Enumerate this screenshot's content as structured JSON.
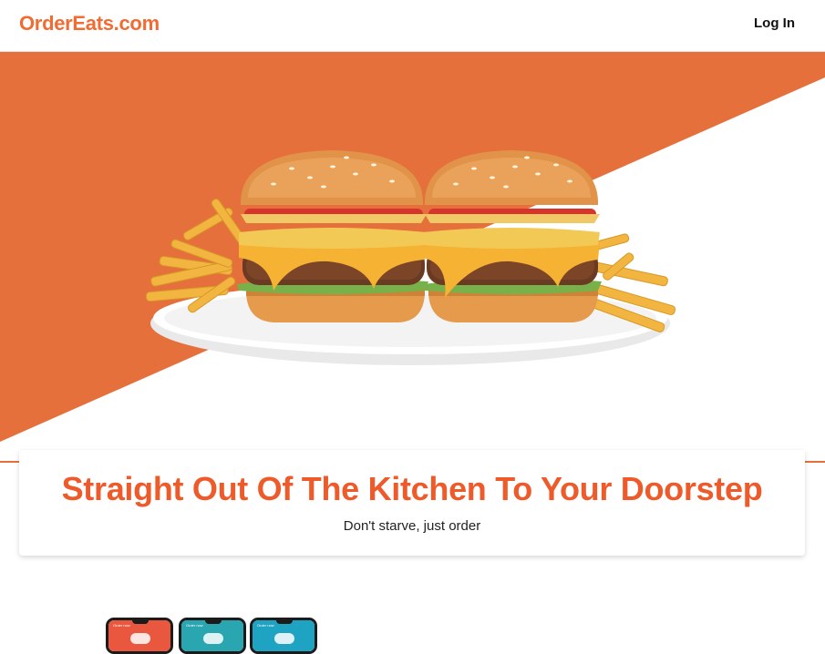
{
  "header": {
    "brand": "OrderEats.com",
    "login_label": "Log In"
  },
  "hero": {
    "image": "burgers-and-fries-photo",
    "accent_color": "#e5703c"
  },
  "tagline": {
    "headline": "Straight Out Of The Kitchen To Your Doorstep",
    "subline": "Don't starve, just order"
  },
  "phones": [
    {
      "label": "Order now",
      "color": "#e9573f"
    },
    {
      "label": "Order now",
      "color": "#2aa6b0"
    },
    {
      "label": "Order now",
      "color": "#1fa3c2"
    }
  ],
  "colors": {
    "brand": "#f26b32",
    "headline": "#ef5a2a",
    "hero_orange": "#e5703c"
  }
}
